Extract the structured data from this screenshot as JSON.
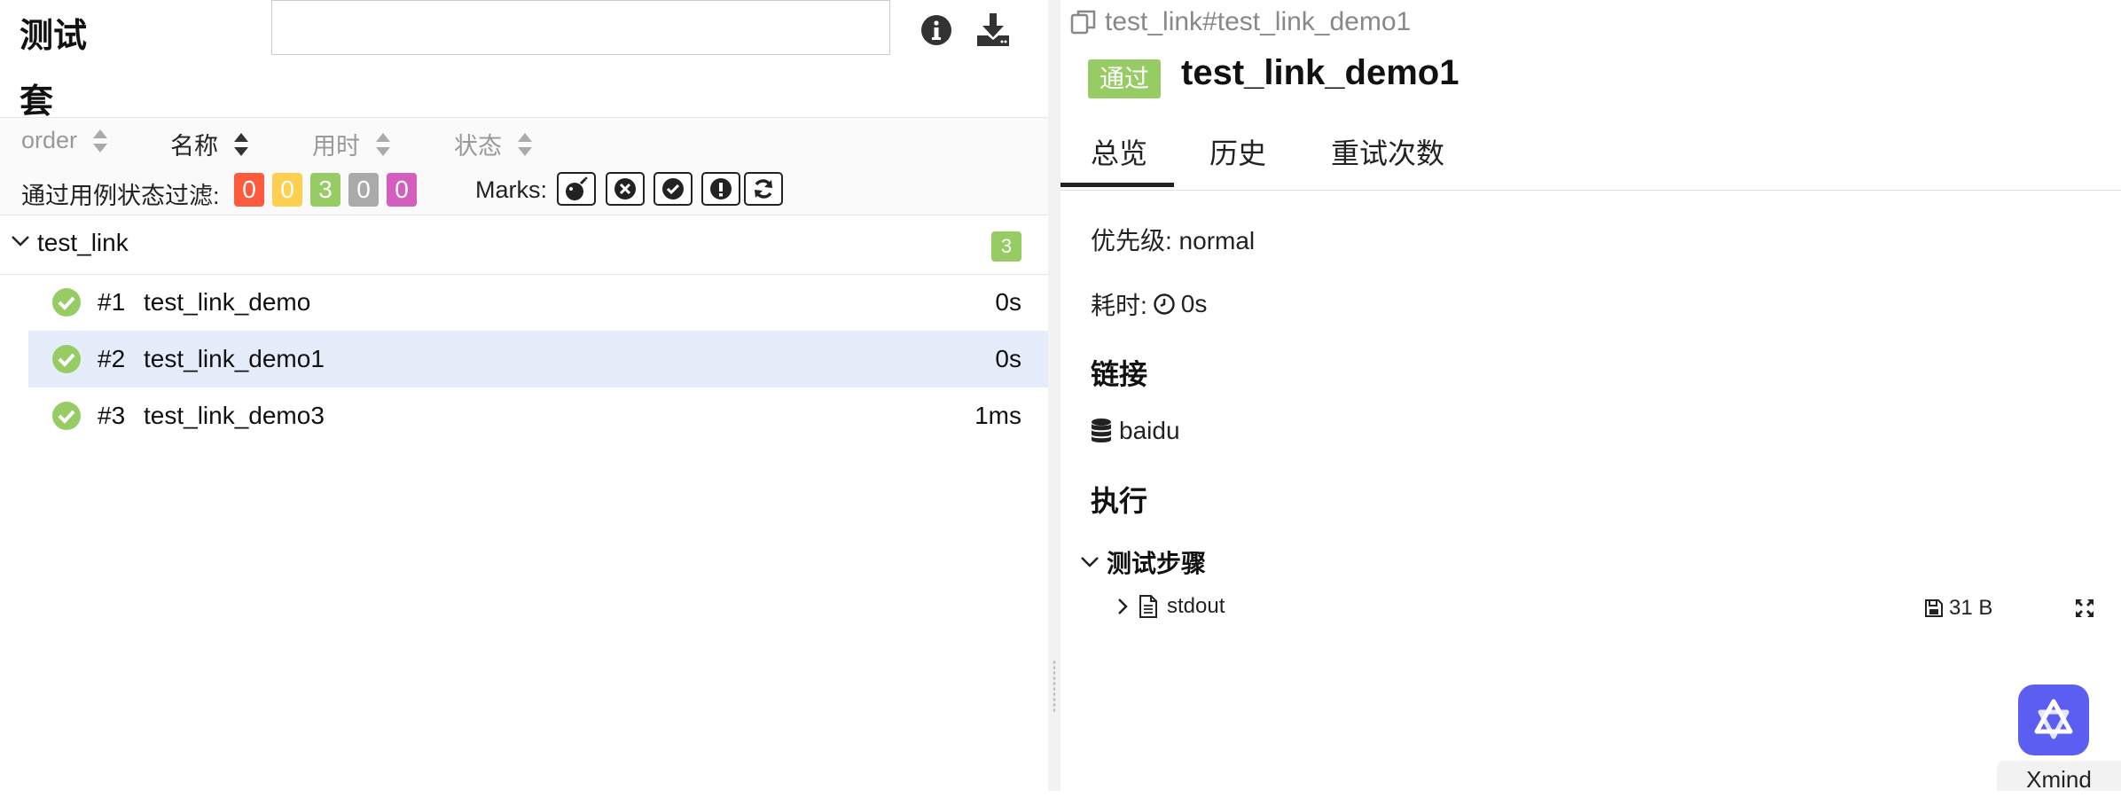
{
  "sidebar_header": {
    "title_line1": "测试",
    "title_line2": "套",
    "search_placeholder": ""
  },
  "sort": {
    "columns": [
      {
        "label": "order",
        "active": false
      },
      {
        "label": "名称",
        "active": true
      },
      {
        "label": "用时",
        "active": false
      },
      {
        "label": "状态",
        "active": false
      }
    ]
  },
  "filters": {
    "label": "通过用例状态过滤:",
    "status_counts": [
      {
        "name": "failed",
        "value": "0",
        "color": "#fd5a3e"
      },
      {
        "name": "broken",
        "value": "0",
        "color": "#ffd050"
      },
      {
        "name": "passed",
        "value": "3",
        "color": "#97cc64"
      },
      {
        "name": "skipped",
        "value": "0",
        "color": "#aaaaaa"
      },
      {
        "name": "unknown",
        "value": "0",
        "color": "#d35ebe"
      }
    ],
    "marks_label": "Marks:",
    "marks": [
      "bomb-icon",
      "times-circle-icon",
      "check-circle-icon",
      "exclamation-circle-icon",
      "refresh-icon"
    ]
  },
  "tree": {
    "group": {
      "name": "test_link",
      "count": "3"
    },
    "tests": [
      {
        "num": "#1",
        "name": "test_link_demo",
        "duration": "0s",
        "selected": false
      },
      {
        "num": "#2",
        "name": "test_link_demo1",
        "duration": "0s",
        "selected": true
      },
      {
        "num": "#3",
        "name": "test_link_demo3",
        "duration": "1ms",
        "selected": false
      }
    ]
  },
  "detail": {
    "breadcrumb": "test_link#test_link_demo1",
    "status": "通过",
    "title": "test_link_demo1",
    "tabs": [
      "总览",
      "历史",
      "重试次数"
    ],
    "active_tab": "总览",
    "severity": "优先级: normal",
    "duration_label": "耗时:",
    "duration_value": "0s",
    "links_title": "链接",
    "link_name": "baidu",
    "execution_title": "执行",
    "steps_title": "测试步骤",
    "attachment": {
      "name": "stdout",
      "size": "31 B"
    }
  },
  "widget": {
    "label": "Xmind"
  },
  "colors": {
    "passed": "#97cc64",
    "selected_row": "#e5edfb",
    "accent": "#5b5ef0"
  }
}
